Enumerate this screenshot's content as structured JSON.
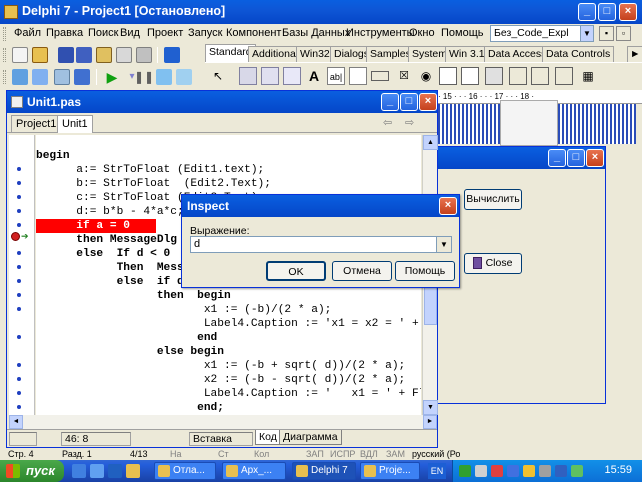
{
  "window": {
    "title": "Delphi 7 - Project1 [Остановлено]",
    "minimize": "_",
    "maximize": "□",
    "close": "×"
  },
  "menu": [
    "Файл",
    "Правка",
    "Поиск",
    "Вид",
    "Проект",
    "Запуск",
    "Компонент",
    "Базы Данных",
    "Инструменты",
    "Окно",
    "Помощь"
  ],
  "desktop_select": {
    "value": "Без_Code_Expl"
  },
  "palette": {
    "tabs": [
      "Standard",
      "Additional",
      "Win32",
      "Dialogs",
      "Samples",
      "System",
      "Win 3.1",
      "Data Access",
      "Data Controls"
    ],
    "active_tab": "Standard",
    "label_icon_text": "A",
    "edit_icon_text": "ab|"
  },
  "editor": {
    "title": "Unit1.pas",
    "tabs": [
      "Project1",
      "Unit1"
    ],
    "active_tab": "Unit1",
    "nav_back": "⇦",
    "nav_fwd": "⇨",
    "lines": [
      "",
      "begin",
      "      a:= StrToFloat (Edit1.text);",
      "      b:= StrToFloat  (Edit2.Text);",
      "      c:= StrToFloat (Edit3.Text);",
      "      d:= b*b - 4*a*c;",
      "      if a = 0",
      "      then MessageDlg",
      "      else  If d < 0",
      "            Then  MessageDlg",
      "            else  if d = 0",
      "                  then  begin",
      "                         x1 := (-b)/(2 * a);",
      "                         Label4.Caption := 'x1 = x2 = ' + F",
      "                        end",
      "                  else begin",
      "                         x1 := (-b + sqrt( d))/(2 * a);",
      "                         x2 := (-b - sqrt( d))/(2 * a);",
      "                         Label4.Caption := '   x1 = ' + Fl",
      "                        end;"
    ],
    "status": {
      "position": "46:  8",
      "mode": "Вставка",
      "tab_code": "Код",
      "tab_diagram": "Диаграмма"
    }
  },
  "ruler": {
    "text": "· 15 · · · 16 · · · 17 · · · 18 ·"
  },
  "form": {
    "calc_button": "Вычислить",
    "close_button": "Close"
  },
  "inspect": {
    "title": "Inspect",
    "label": "Выражение:",
    "value": "d",
    "ok": "OK",
    "cancel": "Отмена",
    "help": "Помощь"
  },
  "main_status": {
    "items": [
      "Стр. 4",
      "Разд. 1",
      "4/13",
      "На",
      "Ст",
      "Кол",
      "ЗАП",
      "ИСПР",
      "ВДЛ",
      "ЗАМ",
      "русский (Ро"
    ]
  },
  "taskbar": {
    "start": "пуск",
    "tasks": [
      "Отла...",
      "Арх_...",
      "Delphi 7",
      "Proje..."
    ],
    "active_task": "Delphi 7",
    "lang": "EN",
    "clock": "15:59"
  }
}
